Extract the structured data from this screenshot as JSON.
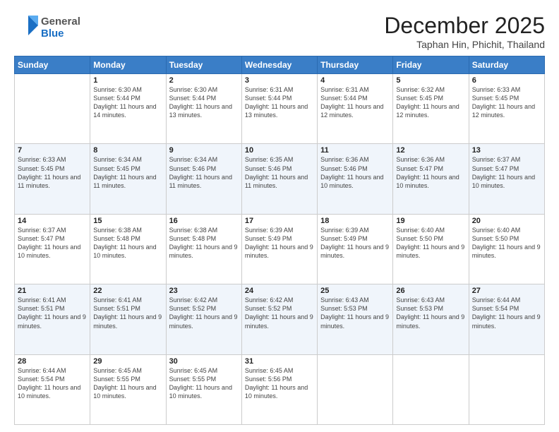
{
  "logo": {
    "general": "General",
    "blue": "Blue"
  },
  "header": {
    "month": "December 2025",
    "location": "Taphan Hin, Phichit, Thailand"
  },
  "weekdays": [
    "Sunday",
    "Monday",
    "Tuesday",
    "Wednesday",
    "Thursday",
    "Friday",
    "Saturday"
  ],
  "weeks": [
    [
      {
        "day": "",
        "sunrise": "",
        "sunset": "",
        "daylight": ""
      },
      {
        "day": "1",
        "sunrise": "Sunrise: 6:30 AM",
        "sunset": "Sunset: 5:44 PM",
        "daylight": "Daylight: 11 hours and 14 minutes."
      },
      {
        "day": "2",
        "sunrise": "Sunrise: 6:30 AM",
        "sunset": "Sunset: 5:44 PM",
        "daylight": "Daylight: 11 hours and 13 minutes."
      },
      {
        "day": "3",
        "sunrise": "Sunrise: 6:31 AM",
        "sunset": "Sunset: 5:44 PM",
        "daylight": "Daylight: 11 hours and 13 minutes."
      },
      {
        "day": "4",
        "sunrise": "Sunrise: 6:31 AM",
        "sunset": "Sunset: 5:44 PM",
        "daylight": "Daylight: 11 hours and 12 minutes."
      },
      {
        "day": "5",
        "sunrise": "Sunrise: 6:32 AM",
        "sunset": "Sunset: 5:45 PM",
        "daylight": "Daylight: 11 hours and 12 minutes."
      },
      {
        "day": "6",
        "sunrise": "Sunrise: 6:33 AM",
        "sunset": "Sunset: 5:45 PM",
        "daylight": "Daylight: 11 hours and 12 minutes."
      }
    ],
    [
      {
        "day": "7",
        "sunrise": "Sunrise: 6:33 AM",
        "sunset": "Sunset: 5:45 PM",
        "daylight": "Daylight: 11 hours and 11 minutes."
      },
      {
        "day": "8",
        "sunrise": "Sunrise: 6:34 AM",
        "sunset": "Sunset: 5:45 PM",
        "daylight": "Daylight: 11 hours and 11 minutes."
      },
      {
        "day": "9",
        "sunrise": "Sunrise: 6:34 AM",
        "sunset": "Sunset: 5:46 PM",
        "daylight": "Daylight: 11 hours and 11 minutes."
      },
      {
        "day": "10",
        "sunrise": "Sunrise: 6:35 AM",
        "sunset": "Sunset: 5:46 PM",
        "daylight": "Daylight: 11 hours and 11 minutes."
      },
      {
        "day": "11",
        "sunrise": "Sunrise: 6:36 AM",
        "sunset": "Sunset: 5:46 PM",
        "daylight": "Daylight: 11 hours and 10 minutes."
      },
      {
        "day": "12",
        "sunrise": "Sunrise: 6:36 AM",
        "sunset": "Sunset: 5:47 PM",
        "daylight": "Daylight: 11 hours and 10 minutes."
      },
      {
        "day": "13",
        "sunrise": "Sunrise: 6:37 AM",
        "sunset": "Sunset: 5:47 PM",
        "daylight": "Daylight: 11 hours and 10 minutes."
      }
    ],
    [
      {
        "day": "14",
        "sunrise": "Sunrise: 6:37 AM",
        "sunset": "Sunset: 5:47 PM",
        "daylight": "Daylight: 11 hours and 10 minutes."
      },
      {
        "day": "15",
        "sunrise": "Sunrise: 6:38 AM",
        "sunset": "Sunset: 5:48 PM",
        "daylight": "Daylight: 11 hours and 10 minutes."
      },
      {
        "day": "16",
        "sunrise": "Sunrise: 6:38 AM",
        "sunset": "Sunset: 5:48 PM",
        "daylight": "Daylight: 11 hours and 9 minutes."
      },
      {
        "day": "17",
        "sunrise": "Sunrise: 6:39 AM",
        "sunset": "Sunset: 5:49 PM",
        "daylight": "Daylight: 11 hours and 9 minutes."
      },
      {
        "day": "18",
        "sunrise": "Sunrise: 6:39 AM",
        "sunset": "Sunset: 5:49 PM",
        "daylight": "Daylight: 11 hours and 9 minutes."
      },
      {
        "day": "19",
        "sunrise": "Sunrise: 6:40 AM",
        "sunset": "Sunset: 5:50 PM",
        "daylight": "Daylight: 11 hours and 9 minutes."
      },
      {
        "day": "20",
        "sunrise": "Sunrise: 6:40 AM",
        "sunset": "Sunset: 5:50 PM",
        "daylight": "Daylight: 11 hours and 9 minutes."
      }
    ],
    [
      {
        "day": "21",
        "sunrise": "Sunrise: 6:41 AM",
        "sunset": "Sunset: 5:51 PM",
        "daylight": "Daylight: 11 hours and 9 minutes."
      },
      {
        "day": "22",
        "sunrise": "Sunrise: 6:41 AM",
        "sunset": "Sunset: 5:51 PM",
        "daylight": "Daylight: 11 hours and 9 minutes."
      },
      {
        "day": "23",
        "sunrise": "Sunrise: 6:42 AM",
        "sunset": "Sunset: 5:52 PM",
        "daylight": "Daylight: 11 hours and 9 minutes."
      },
      {
        "day": "24",
        "sunrise": "Sunrise: 6:42 AM",
        "sunset": "Sunset: 5:52 PM",
        "daylight": "Daylight: 11 hours and 9 minutes."
      },
      {
        "day": "25",
        "sunrise": "Sunrise: 6:43 AM",
        "sunset": "Sunset: 5:53 PM",
        "daylight": "Daylight: 11 hours and 9 minutes."
      },
      {
        "day": "26",
        "sunrise": "Sunrise: 6:43 AM",
        "sunset": "Sunset: 5:53 PM",
        "daylight": "Daylight: 11 hours and 9 minutes."
      },
      {
        "day": "27",
        "sunrise": "Sunrise: 6:44 AM",
        "sunset": "Sunset: 5:54 PM",
        "daylight": "Daylight: 11 hours and 9 minutes."
      }
    ],
    [
      {
        "day": "28",
        "sunrise": "Sunrise: 6:44 AM",
        "sunset": "Sunset: 5:54 PM",
        "daylight": "Daylight: 11 hours and 10 minutes."
      },
      {
        "day": "29",
        "sunrise": "Sunrise: 6:45 AM",
        "sunset": "Sunset: 5:55 PM",
        "daylight": "Daylight: 11 hours and 10 minutes."
      },
      {
        "day": "30",
        "sunrise": "Sunrise: 6:45 AM",
        "sunset": "Sunset: 5:55 PM",
        "daylight": "Daylight: 11 hours and 10 minutes."
      },
      {
        "day": "31",
        "sunrise": "Sunrise: 6:45 AM",
        "sunset": "Sunset: 5:56 PM",
        "daylight": "Daylight: 11 hours and 10 minutes."
      },
      {
        "day": "",
        "sunrise": "",
        "sunset": "",
        "daylight": ""
      },
      {
        "day": "",
        "sunrise": "",
        "sunset": "",
        "daylight": ""
      },
      {
        "day": "",
        "sunrise": "",
        "sunset": "",
        "daylight": ""
      }
    ]
  ]
}
